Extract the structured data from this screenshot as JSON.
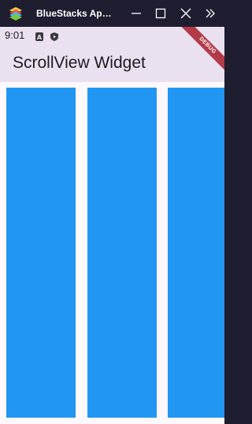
{
  "window": {
    "title": "BlueStacks Ap…",
    "icons": [
      "bluestacks-logo",
      "minimize-icon",
      "maximize-icon",
      "close-icon",
      "expand-sidebar-icon"
    ]
  },
  "statusbar": {
    "time": "9:01",
    "icons": [
      "a-notification-icon",
      "shield-play-icon"
    ]
  },
  "appbar": {
    "title": "ScrollView Widget"
  },
  "debug_banner": "DEBUG",
  "scroll_panels": {
    "count_visible": 3,
    "color": "#2196f3"
  },
  "colors": {
    "titlebar": "#1f1d30",
    "appbar": "#e9e1ef",
    "background": "#fdf7ff",
    "panel": "#2196f3",
    "debug": "#b33a48"
  }
}
